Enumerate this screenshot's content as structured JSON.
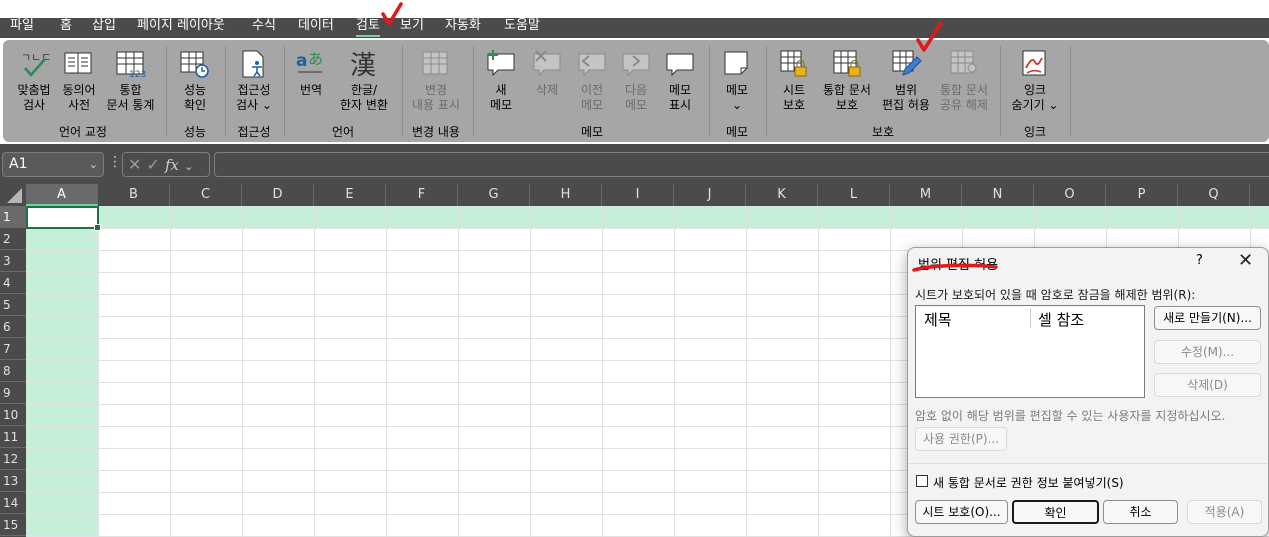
{
  "menu": {
    "tabs": [
      "파일",
      "홈",
      "삽입",
      "페이지 레이아웃",
      "수식",
      "데이터",
      "검토",
      "보기",
      "자동화",
      "도움말"
    ],
    "active": "검토"
  },
  "ribbon": {
    "groups": [
      {
        "label": "언어 교정",
        "buttons": [
          {
            "line1": "맞춤법",
            "line2": "검사",
            "icon": "spellcheck-icon"
          },
          {
            "line1": "동의어",
            "line2": "사전",
            "icon": "thesaurus-icon"
          },
          {
            "line1": "통합",
            "line2": "문서 통계",
            "icon": "workbook-stats-icon"
          }
        ]
      },
      {
        "label": "성능",
        "buttons": [
          {
            "line1": "성능",
            "line2": "확인",
            "icon": "performance-icon"
          }
        ]
      },
      {
        "label": "접근성",
        "buttons": [
          {
            "line1": "접근성",
            "line2": "검사 ⌄",
            "icon": "accessibility-icon"
          }
        ]
      },
      {
        "label": "언어",
        "buttons": [
          {
            "line1": "번역",
            "line2": "",
            "icon": "translate-icon"
          },
          {
            "line1": "한글/",
            "line2": "한자 변환",
            "icon": "hanja-icon"
          }
        ]
      },
      {
        "label": "변경 내용",
        "buttons": [
          {
            "line1": "변경",
            "line2": "내용 표시",
            "icon": "show-changes-icon",
            "disabled": true
          }
        ]
      },
      {
        "label": "메모",
        "buttons": [
          {
            "line1": "새",
            "line2": "메모",
            "icon": "new-comment-icon"
          },
          {
            "line1": "삭제",
            "line2": "",
            "icon": "delete-comment-icon",
            "disabled": true
          },
          {
            "line1": "이전",
            "line2": "메모",
            "icon": "previous-comment-icon",
            "disabled": true
          },
          {
            "line1": "다음",
            "line2": "메모",
            "icon": "next-comment-icon",
            "disabled": true
          },
          {
            "line1": "메모",
            "line2": "표시",
            "icon": "show-comments-icon"
          }
        ]
      },
      {
        "label": "메모",
        "buttons": [
          {
            "line1": "메모",
            "line2": "⌄",
            "icon": "notes-icon"
          }
        ]
      },
      {
        "label": "보호",
        "buttons": [
          {
            "line1": "시트",
            "line2": "보호",
            "icon": "protect-sheet-icon"
          },
          {
            "line1": "통합 문서",
            "line2": "보호",
            "icon": "protect-workbook-icon"
          },
          {
            "line1": "범위",
            "line2": "편집 허용",
            "icon": "allow-edit-ranges-icon"
          },
          {
            "line1": "통합 문서",
            "line2": "공유 해제",
            "icon": "unshare-workbook-icon",
            "disabled": true
          }
        ]
      },
      {
        "label": "잉크",
        "buttons": [
          {
            "line1": "잉크",
            "line2": "숨기기 ⌄",
            "icon": "hide-ink-icon"
          }
        ]
      }
    ]
  },
  "formula_bar": {
    "name_box": "A1",
    "fx": "fx",
    "value": ""
  },
  "grid": {
    "columns": [
      "A",
      "B",
      "C",
      "D",
      "E",
      "F",
      "G",
      "H",
      "I",
      "J",
      "K",
      "L",
      "M",
      "N",
      "O",
      "P",
      "Q"
    ],
    "rows": [
      "1",
      "2",
      "3",
      "4",
      "5",
      "6",
      "7",
      "8",
      "9",
      "10",
      "11",
      "12",
      "13",
      "14",
      "15"
    ],
    "active_cell": "A1"
  },
  "dialog": {
    "title": "범위 편집 허용",
    "help": "?",
    "close": "✕",
    "ranges_label": "시트가 보호되어 있을 때 암호로 잠금을 해제한 범위(R):",
    "col_title": "제목",
    "col_ref": "셀 참조",
    "btn_new": "새로 만들기(N)...",
    "btn_modify": "수정(M)...",
    "btn_delete": "삭제(D)",
    "hint": "암호 없이 해당 범위를 편집할 수 있는 사용자를 지정하십시오.",
    "btn_permissions": "사용 권한(P)...",
    "checkbox_label": "새 통합 문서로 권한 정보 붙여넣기(S)",
    "btn_protect_sheet": "시트 보호(O)...",
    "btn_ok": "확인",
    "btn_cancel": "취소",
    "btn_apply": "적용(A)"
  },
  "colors": {
    "accent": "#1e7145",
    "selection": "#c6efd9",
    "annotation": "#e0191b"
  }
}
